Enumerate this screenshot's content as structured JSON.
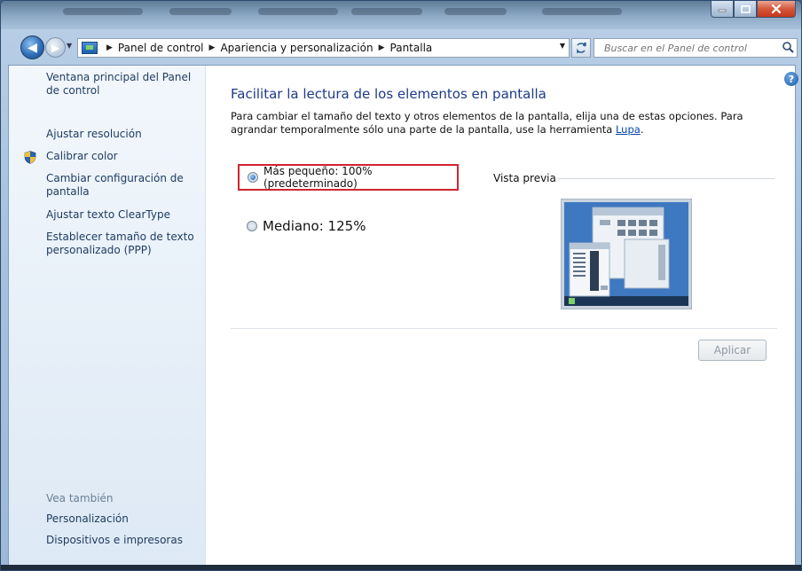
{
  "window": {
    "breadcrumbs": [
      "Panel de control",
      "Apariencia y personalización",
      "Pantalla"
    ],
    "search_placeholder": "Buscar en el Panel de control"
  },
  "sidebar": {
    "links": [
      {
        "label": "Ventana principal del Panel de control"
      },
      {
        "label": "Ajustar resolución"
      },
      {
        "label": "Calibrar color"
      },
      {
        "label": "Cambiar configuración de pantalla"
      },
      {
        "label": "Ajustar texto ClearType"
      },
      {
        "label": "Establecer tamaño de texto personalizado (PPP)"
      }
    ],
    "see_also_title": "Vea también",
    "see_also": [
      {
        "label": "Personalización"
      },
      {
        "label": "Dispositivos e impresoras"
      }
    ]
  },
  "main": {
    "heading": "Facilitar la lectura de los elementos en pantalla",
    "description": "Para cambiar el tamaño del texto y otros elementos de la pantalla, elija una de estas opciones. Para agrandar temporalmente sólo una parte de la pantalla, use la herramienta",
    "description_link": "Lupa",
    "description_end": ".",
    "options": [
      {
        "label": "Más pequeño: 100% (predeterminado)",
        "selected": true
      },
      {
        "label": "Mediano: 125%",
        "selected": false
      }
    ],
    "preview_label": "Vista previa",
    "apply_label": "Aplicar"
  },
  "colors": {
    "highlight_border": "#d0252f",
    "link": "#0645ad",
    "heading": "#1e3a8a"
  }
}
